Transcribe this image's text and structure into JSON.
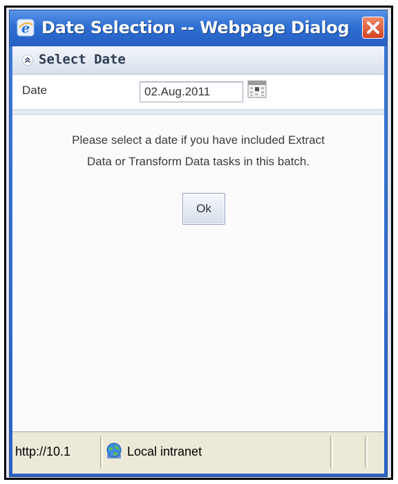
{
  "window": {
    "title": "Date Selection -- Webpage Dialog",
    "title_bar_color": "#2f6fd2",
    "close_color": "#d4421f"
  },
  "section": {
    "title": "Select Date",
    "icon": "collapse-up-icon"
  },
  "form": {
    "date_label": "Date",
    "date_value": "02.Aug.2011",
    "calendar_icon": "calendar-icon"
  },
  "message": {
    "line1": "Please select a date if you have included Extract",
    "line2": "Data or Transform Data tasks in this batch."
  },
  "buttons": {
    "ok_label": "Ok"
  },
  "statusbar": {
    "url": "http://10.1",
    "zone": "Local intranet",
    "zone_icon": "globe-icon"
  }
}
